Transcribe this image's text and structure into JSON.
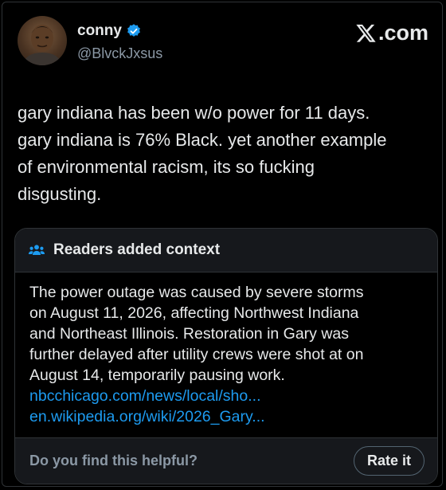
{
  "author": {
    "name": "conny",
    "handle": "@BlvckJxsus",
    "verified_icon": "verified-badge-icon",
    "verified_color": "#1d9bf0"
  },
  "brand": {
    "label": ".com",
    "logo_icon": "x-logo-icon"
  },
  "tweet": {
    "lines": [
      "gary indiana has been w/o power for 11 days.",
      "gary indiana is 76% Black. yet another example",
      "of environmental racism, its so fucking",
      "disgusting."
    ]
  },
  "community_note": {
    "title": "Readers added context",
    "title_icon": "people-icon",
    "icon_color": "#1d9bf0",
    "body_lines": [
      "The power outage was caused by severe storms",
      "on August 11, 2026, affecting Northwest Indiana",
      "and Northeast Illinois. Restoration in Gary was",
      "further delayed after utility crews were shot at on",
      "August 14, temporarily pausing work."
    ],
    "links": [
      "nbcchicago.com/news/local/sho...",
      "en.wikipedia.org/wiki/2026_Gary..."
    ],
    "link_color": "#1d9bf0",
    "helpful_question": "Do you find this helpful?",
    "rate_button": "Rate it"
  }
}
